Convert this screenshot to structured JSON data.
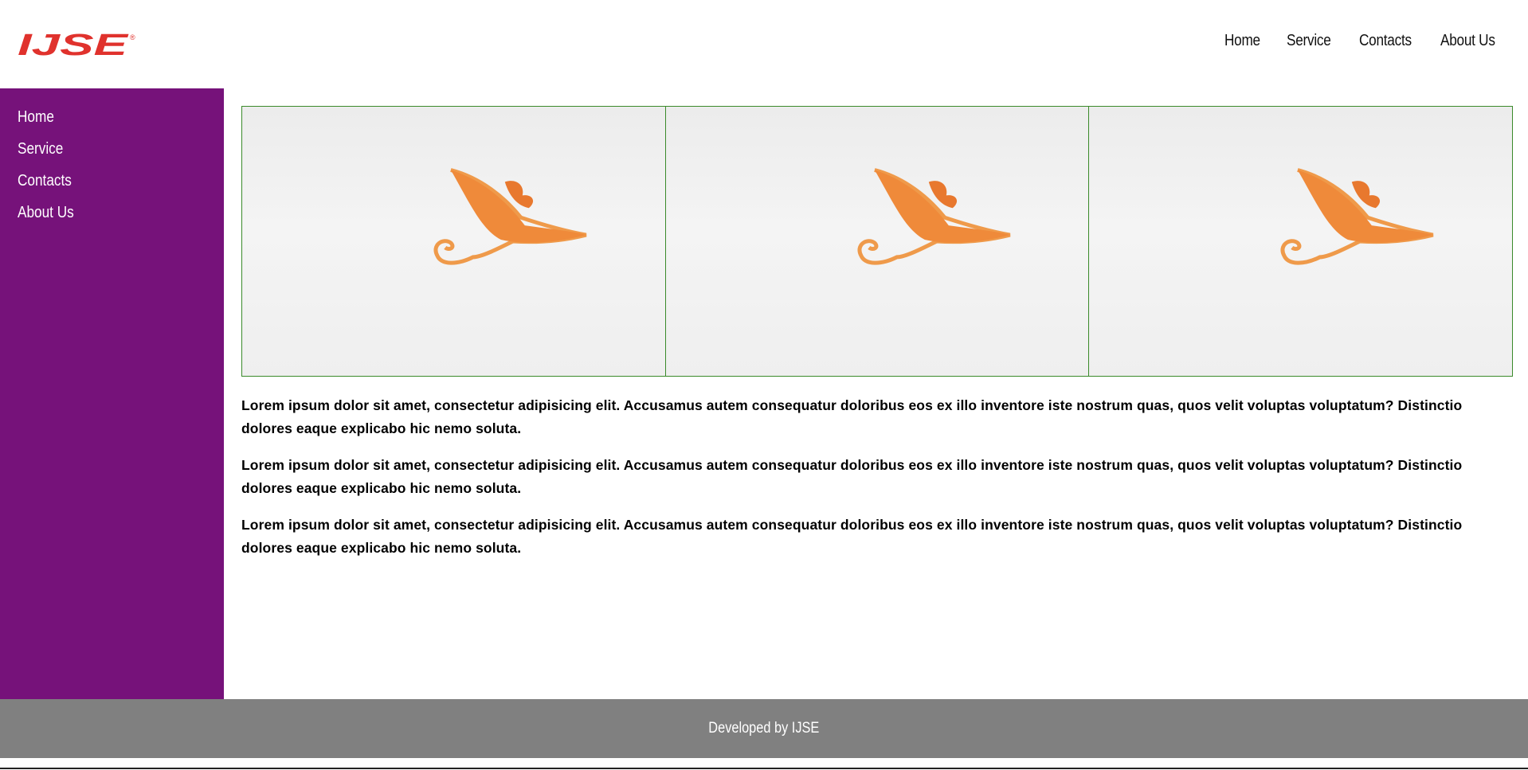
{
  "header": {
    "logo_text": "IJSE",
    "logo_mark": "®",
    "logo_color": "#e0322d",
    "nav": [
      {
        "label": "Home"
      },
      {
        "label": "Service"
      },
      {
        "label": "Contacts"
      },
      {
        "label": "About Us"
      }
    ]
  },
  "sidebar": {
    "background": "#76127a",
    "items": [
      {
        "label": "Home"
      },
      {
        "label": "Service"
      },
      {
        "label": "Contacts"
      },
      {
        "label": "About Us"
      }
    ]
  },
  "gallery": {
    "border_color": "#3a8a2a",
    "images": [
      {
        "icon": "orange-lamp-logo-image"
      },
      {
        "icon": "orange-lamp-logo-image"
      },
      {
        "icon": "orange-lamp-logo-image"
      }
    ]
  },
  "content": {
    "paragraphs": [
      "Lorem ipsum dolor sit amet, consectetur adipisicing elit. Accusamus autem consequatur doloribus eos ex illo inventore iste nostrum quas, quos velit voluptas voluptatum? Distinctio dolores eaque explicabo hic nemo soluta.",
      "Lorem ipsum dolor sit amet, consectetur adipisicing elit. Accusamus autem consequatur doloribus eos ex illo inventore iste nostrum quas, quos velit voluptas voluptatum? Distinctio dolores eaque explicabo hic nemo soluta.",
      "Lorem ipsum dolor sit amet, consectetur adipisicing elit. Accusamus autem consequatur doloribus eos ex illo inventore iste nostrum quas, quos velit voluptas voluptatum? Distinctio dolores eaque explicabo hic nemo soluta."
    ]
  },
  "footer": {
    "text": "Developed by IJSE",
    "background": "#808080"
  }
}
